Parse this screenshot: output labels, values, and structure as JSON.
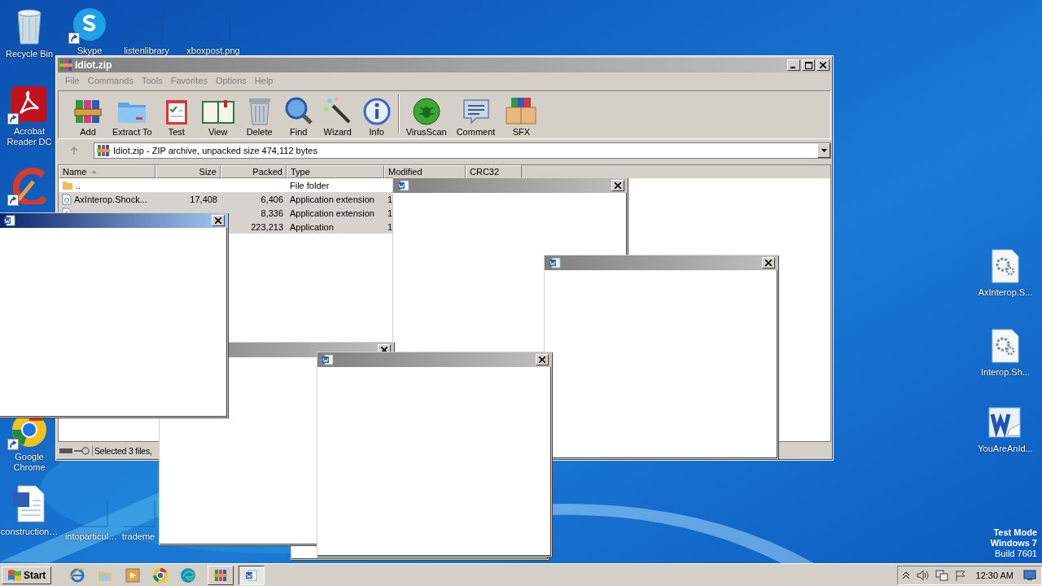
{
  "desktop_icons": [
    {
      "label": "Recycle Bin",
      "shortcut": false
    },
    {
      "label": "Skype",
      "shortcut": true
    },
    {
      "label": "listenlibrary",
      "shortcut": false
    },
    {
      "label": "xboxpost.png",
      "shortcut": false
    },
    {
      "label": "Acrobat Reader DC",
      "shortcut": true
    },
    {
      "shortcut": true
    },
    {
      "label": "Google Chrome",
      "shortcut": true
    },
    {
      "label": "construction…",
      "shortcut": false
    },
    {
      "label": "intoparticul…",
      "shortcut": false
    },
    {
      "label": "trademe",
      "shortcut": false
    },
    {
      "label": "AxInterop.S...",
      "shortcut": false
    },
    {
      "label": "Interop.Sh...",
      "shortcut": false
    },
    {
      "label": "YouAreAnId...",
      "shortcut": false
    }
  ],
  "window": {
    "title": "Idiot.zip",
    "menu": [
      "File",
      "Commands",
      "Tools",
      "Favorites",
      "Options",
      "Help"
    ],
    "toolbar": [
      {
        "label": "Add"
      },
      {
        "label": "Extract To"
      },
      {
        "label": "Test"
      },
      {
        "label": "View"
      },
      {
        "label": "Delete"
      },
      {
        "label": "Find"
      },
      {
        "label": "Wizard"
      },
      {
        "label": "Info"
      },
      {
        "label": "VirusScan"
      },
      {
        "label": "Comment"
      },
      {
        "label": "SFX"
      }
    ],
    "address": "Idiot.zip - ZIP archive, unpacked size 474,112 bytes",
    "columns": [
      "Name",
      "Size",
      "Packed",
      "Type",
      "Modified",
      "CRC32"
    ],
    "rows": [
      {
        "name": "..",
        "size": "",
        "packed": "",
        "type": "File folder",
        "modified": "",
        "selected": false
      },
      {
        "name": "AxInterop.Shock...",
        "size": "17,408",
        "packed": "6,406",
        "type": "Application extension",
        "modified": "1",
        "selected": true
      },
      {
        "name": "",
        "size": "",
        "packed": "8,336",
        "type": "Application extension",
        "modified": "1",
        "selected": true
      },
      {
        "name": "",
        "size": "",
        "packed": "223,213",
        "type": "Application",
        "modified": "1",
        "selected": true
      }
    ],
    "status": "Selected 3 files,"
  },
  "popup_windows": [
    {
      "kind": "document"
    },
    {
      "kind": "document"
    },
    {
      "kind": "blank"
    },
    {
      "kind": "bare"
    },
    {
      "kind": "document"
    },
    {
      "kind": "document"
    }
  ],
  "watermark_text": [
    "Test Mode",
    "Windows 7",
    "Build 7601"
  ],
  "taskbar": {
    "start": "Start",
    "tasks": [
      {
        "selected": false
      },
      {
        "selected": true
      }
    ],
    "clock": "12:30 AM"
  }
}
